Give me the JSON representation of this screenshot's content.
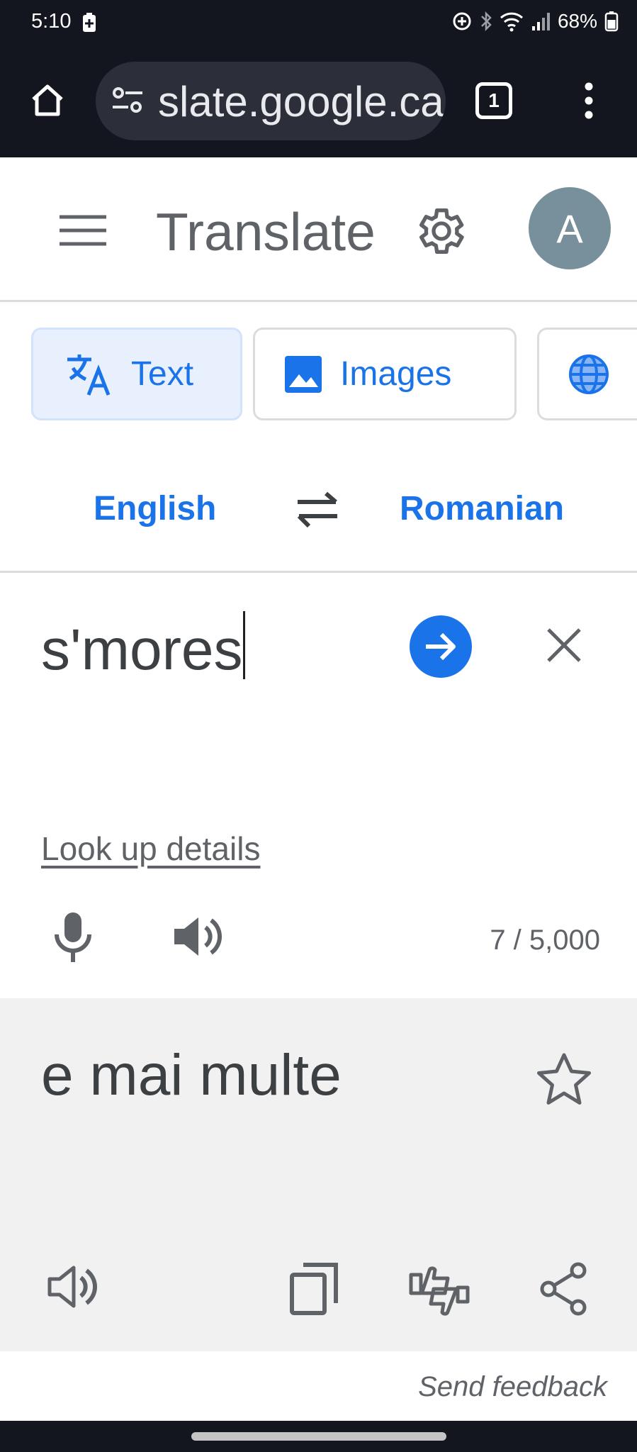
{
  "status_bar": {
    "time": "5:10",
    "battery": "68%"
  },
  "browser": {
    "url": "slate.google.ca",
    "tab_count": "1"
  },
  "header": {
    "title": "Translate",
    "avatar_letter": "A"
  },
  "modes": {
    "text": "Text",
    "images": "Images",
    "active": "text"
  },
  "languages": {
    "source": "English",
    "target": "Romanian"
  },
  "input": {
    "value": "s'mores",
    "lookup_label": "Look up details",
    "char_count": "7 / 5,000"
  },
  "output": {
    "value": "e mai multe"
  },
  "footer": {
    "feedback": "Send feedback"
  },
  "colors": {
    "accent": "#1a73e8",
    "chrome_bg": "#13151f",
    "result_bg": "#f1f1f1",
    "avatar_bg": "#78909c"
  }
}
